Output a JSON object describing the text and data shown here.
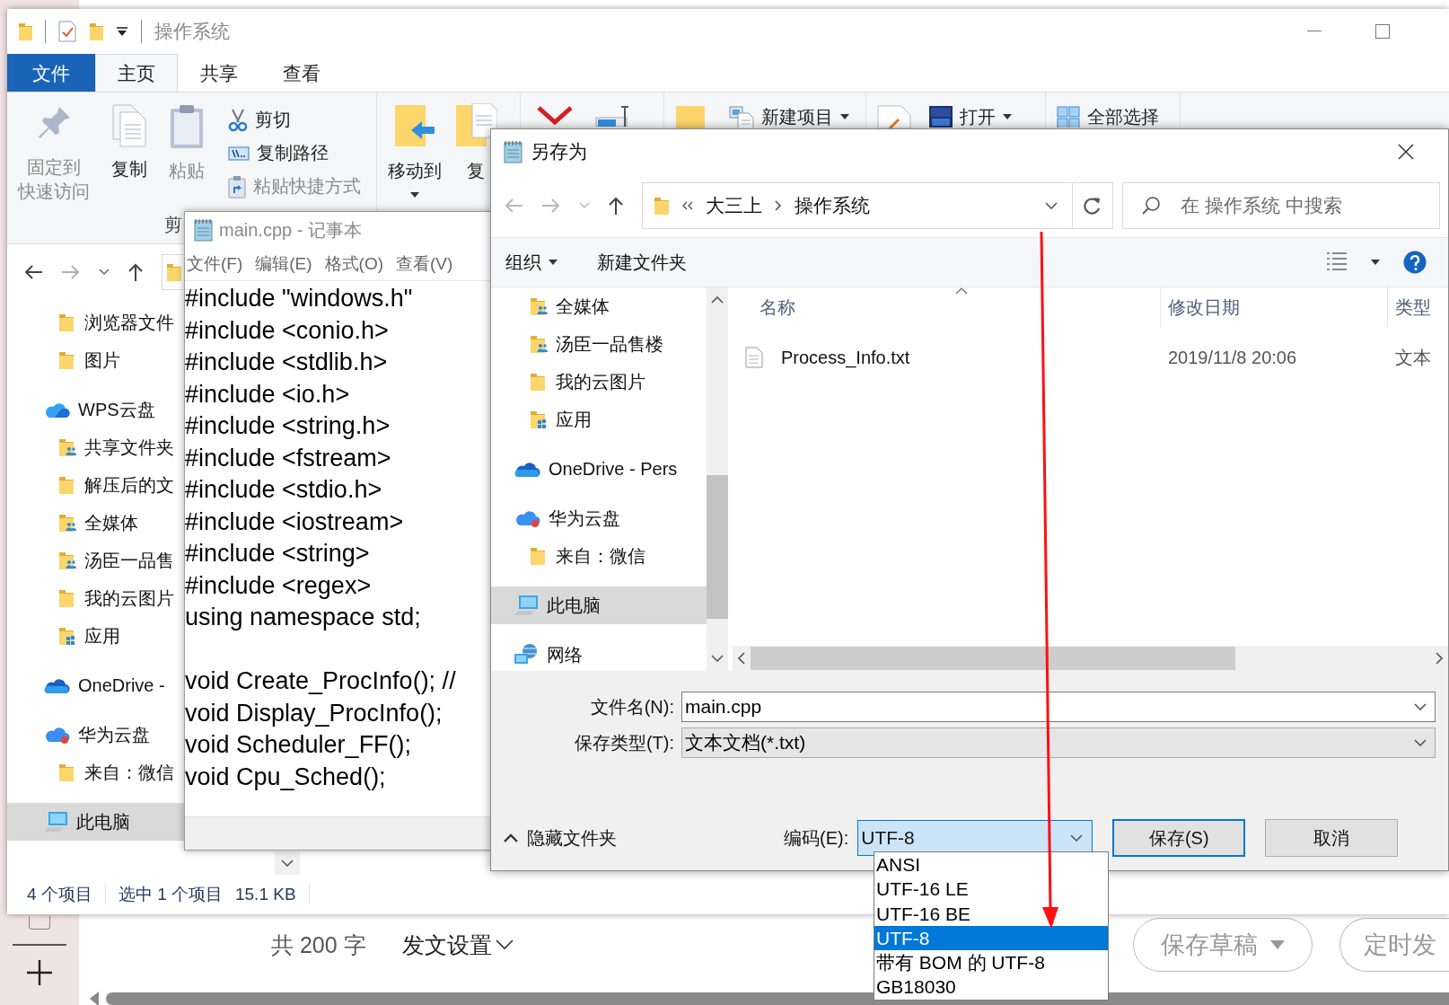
{
  "explorer": {
    "title": "操作系统",
    "tabs": [
      {
        "label": "文件",
        "kind": "file",
        "selected": false
      },
      {
        "label": "主页",
        "kind": "tab",
        "selected": true
      },
      {
        "label": "共享",
        "kind": "tab",
        "selected": false
      },
      {
        "label": "查看",
        "kind": "tab",
        "selected": false
      }
    ],
    "ribbon": {
      "large": [
        {
          "lines": [
            "固定到",
            "快速访问"
          ],
          "kind": "pin",
          "disabled": true
        },
        {
          "lines": [
            "复制"
          ],
          "kind": "copy",
          "disabled": false
        },
        {
          "lines": [
            "粘贴"
          ],
          "kind": "paste",
          "disabled": true
        }
      ],
      "small": [
        {
          "label": "剪切",
          "kind": "cut",
          "disabled": false
        },
        {
          "label": "复制路径",
          "kind": "path",
          "disabled": false
        },
        {
          "label": "粘贴快捷方式",
          "kind": "shortcut",
          "disabled": true
        }
      ],
      "group_label": "剪",
      "organize": [
        {
          "label": "移动到",
          "kind": "move",
          "dropdown": true
        },
        {
          "label": "复",
          "kind": "copyto",
          "dropdown": false
        }
      ],
      "top_row": [
        {
          "label": "新建项目",
          "kind": "new-item",
          "dropdown": true
        },
        {
          "label": "打开",
          "kind": "open",
          "dropdown": true
        },
        {
          "label": "全部选择",
          "kind": "select-all",
          "dropdown": false
        }
      ]
    },
    "nav": [
      {
        "label": "浏览器文件",
        "kind": "folder",
        "selected": false
      },
      {
        "label": "图片",
        "kind": "folder",
        "selected": false
      },
      {
        "label": "WPS云盘",
        "kind": "wps",
        "selected": false,
        "children": [
          {
            "label": "共享文件夹",
            "kind": "shared",
            "selected": false
          },
          {
            "label": "解压后的文",
            "kind": "folder",
            "selected": false
          },
          {
            "label": "全媒体",
            "kind": "shared",
            "selected": false
          },
          {
            "label": "汤臣一品售",
            "kind": "shared",
            "selected": false
          },
          {
            "label": "我的云图片",
            "kind": "folder",
            "selected": false
          },
          {
            "label": "应用",
            "kind": "apps",
            "selected": false
          }
        ]
      },
      {
        "label": "OneDrive -",
        "kind": "onedrive",
        "selected": false
      },
      {
        "label": "华为云盘",
        "kind": "huawei",
        "selected": false,
        "children": [
          {
            "label": "来自：微信",
            "kind": "folder",
            "selected": false
          }
        ]
      },
      {
        "label": "此电脑",
        "kind": "pc",
        "selected": true
      }
    ],
    "status": [
      "4 个项目",
      "选中 1 个项目",
      "15.1 KB"
    ]
  },
  "notepad": {
    "title": "main.cpp - 记事本",
    "menu": [
      "文件(F)",
      "编辑(E)",
      "格式(O)",
      "查看(V)"
    ],
    "code_blocks": [
      [
        "#include \"windows.h\"",
        "#include <conio.h>",
        "#include <stdlib.h>",
        "#include <io.h>",
        "#include <string.h>",
        "#include <fstream>",
        "#include <stdio.h>",
        "#include <iostream>",
        "#include <string>",
        "#include <regex>",
        "using namespace std;"
      ],
      [
        "void Create_ProcInfo(); //",
        "void Display_ProcInfo();",
        "void Scheduler_FF();",
        "void Cpu_Sched();"
      ]
    ]
  },
  "save_dialog": {
    "title": "另存为",
    "path": [
      "大三上",
      "操作系统"
    ],
    "search": {
      "placeholder": "在 操作系统 中搜索"
    },
    "toolbar": [
      {
        "label": "组织",
        "dropdown": true
      },
      {
        "label": "新建文件夹",
        "dropdown": false
      }
    ],
    "nav": [
      {
        "label": "全媒体",
        "kind": "shared",
        "selected": false
      },
      {
        "label": "汤臣一品售楼",
        "kind": "shared",
        "selected": false
      },
      {
        "label": "我的云图片",
        "kind": "folder",
        "selected": false
      },
      {
        "label": "应用",
        "kind": "apps",
        "selected": false
      },
      {
        "label": "OneDrive - Pers",
        "kind": "onedrive",
        "selected": false
      },
      {
        "label": "华为云盘",
        "kind": "huawei",
        "selected": false,
        "children": [
          {
            "label": "来自：微信",
            "kind": "folder",
            "selected": false
          }
        ]
      },
      {
        "label": "此电脑",
        "kind": "pc",
        "selected": true
      },
      {
        "label": "网络",
        "kind": "network",
        "selected": false
      }
    ],
    "columns": [
      "名称",
      "修改日期",
      "类型"
    ],
    "rows": [
      {
        "name": "Process_Info.txt",
        "modified": "2019/11/8 20:06",
        "type": "文本"
      }
    ],
    "file_name": {
      "label": "文件名(N):",
      "value": "main.cpp"
    },
    "save_type": {
      "label": "保存类型(T):",
      "value": "文本文档(*.txt)"
    },
    "hide_folders": "隐藏文件夹",
    "encoding": {
      "label": "编码(E):",
      "value": "UTF-8",
      "expanded": true,
      "options": [
        {
          "label": "ANSI",
          "selected": false
        },
        {
          "label": "UTF-16 LE",
          "selected": false
        },
        {
          "label": "UTF-16 BE",
          "selected": false
        },
        {
          "label": "UTF-8",
          "selected": true
        },
        {
          "label": "带有 BOM 的 UTF-8",
          "selected": false
        },
        {
          "label": "GB18030",
          "selected": false
        }
      ]
    },
    "buttons": [
      {
        "label": "保存(S)",
        "default": true
      },
      {
        "label": "取消",
        "default": false
      }
    ]
  },
  "editor_bar": {
    "word_count": "共 200 字",
    "settings": "发文设置",
    "buttons": [
      {
        "label": "保存草稿",
        "dropdown": true
      },
      {
        "label": "定时发",
        "dropdown": false
      }
    ]
  }
}
